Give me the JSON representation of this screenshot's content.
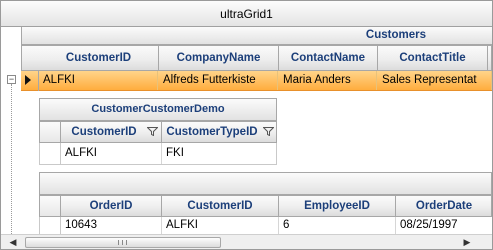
{
  "grid": {
    "title": "ultraGrid1"
  },
  "customers_band": {
    "title": "Customers",
    "columns": [
      "CustomerID",
      "CompanyName",
      "ContactName",
      "ContactTitle"
    ],
    "row": [
      "ALFKI",
      "Alfreds Futterkiste",
      "Maria Anders",
      "Sales Representat"
    ],
    "expander": "−"
  },
  "customer_demo_band": {
    "title": "CustomerCustomerDemo",
    "columns": [
      "CustomerID",
      "CustomerTypeID"
    ],
    "row": [
      "ALFKI",
      "FKI"
    ]
  },
  "orders_band": {
    "columns": [
      "OrderID",
      "CustomerID",
      "EmployeeID",
      "OrderDate"
    ],
    "row": [
      "10643",
      "ALFKI",
      "6",
      "08/25/1997"
    ]
  },
  "scrollbar": {
    "left_arrow": "◀",
    "right_arrow": "▶"
  },
  "colors": {
    "selected_row": "#ffad3e",
    "header_text": "#1c3f7a"
  }
}
